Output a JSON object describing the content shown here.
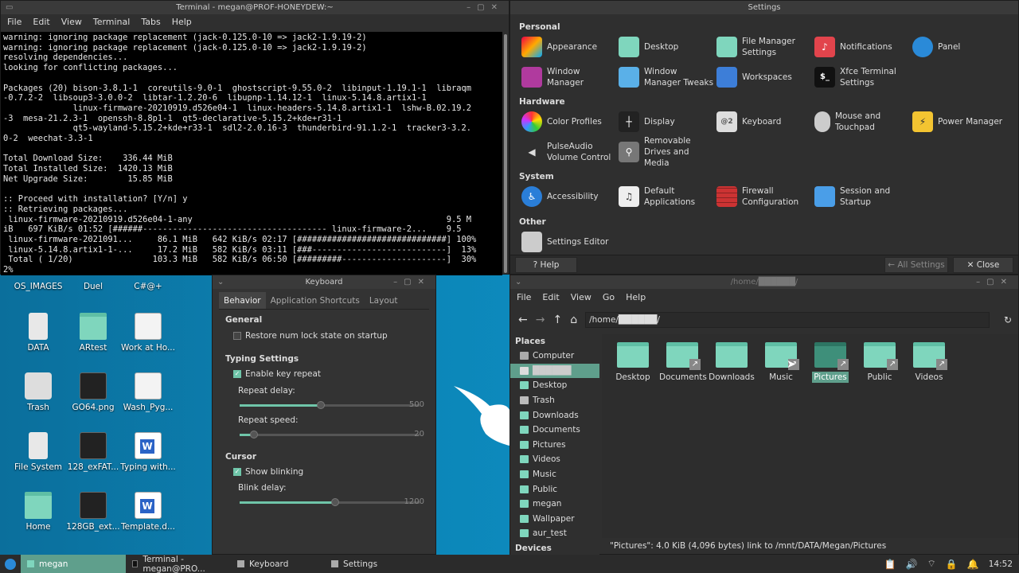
{
  "terminal": {
    "title": "Terminal - megan@PROF-HONEYDEW:~",
    "menu": [
      "File",
      "Edit",
      "View",
      "Terminal",
      "Tabs",
      "Help"
    ],
    "lines": [
      "warning: ignoring package replacement (jack-0.125.0-10 => jack2-1.9.19-2)",
      "warning: ignoring package replacement (jack-0.125.0-10 => jack2-1.9.19-2)",
      "resolving dependencies...",
      "looking for conflicting packages...",
      "",
      "Packages (20) bison-3.8.1-1  coreutils-9.0-1  ghostscript-9.55.0-2  libinput-1.19.1-1  libraqm",
      "-0.7.2-2  libsoup3-3.0.0-2  libtar-1.2.20-6  libupnp-1.14.12-1  linux-5.14.8.artix1-1",
      "              linux-firmware-20210919.d526e04-1  linux-headers-5.14.8.artix1-1  lshw-B.02.19.2",
      "-3  mesa-21.2.3-1  openssh-8.8p1-1  qt5-declarative-5.15.2+kde+r31-1",
      "              qt5-wayland-5.15.2+kde+r33-1  sdl2-2.0.16-3  thunderbird-91.1.2-1  tracker3-3.2.",
      "0-2  weechat-3.3-1",
      "",
      "Total Download Size:    336.44 MiB",
      "Total Installed Size:  1420.13 MiB",
      "Net Upgrade Size:        15.85 MiB",
      "",
      ":: Proceed with installation? [Y/n] y",
      ":: Retrieving packages...",
      " linux-firmware-20210919.d526e04-1-any                                                   9.5 M",
      "iB   697 KiB/s 01:52 [######------------------------------------- linux-firmware-2...    9.5",
      " linux-firmware-2021091...     86.1 MiB   642 KiB/s 02:17 [##############################] 100%",
      " linux-5.14.8.artix1-1-...     17.2 MiB   582 KiB/s 03:11 [###---------------------------]  13%",
      " Total ( 1/20)                103.3 MiB   582 KiB/s 06:50 [#########---------------------]  30%",
      "2%"
    ]
  },
  "settings": {
    "title": "Settings",
    "sections": {
      "personal": "Personal",
      "hardware": "Hardware",
      "system": "System",
      "other": "Other"
    },
    "items": {
      "appearance": "Appearance",
      "desktop": "Desktop",
      "file_manager": "File Manager Settings",
      "notifications": "Notifications",
      "panel": "Panel",
      "window_manager": "Window Manager",
      "wm_tweaks": "Window Manager Tweaks",
      "workspaces": "Workspaces",
      "terminal_settings": "Xfce Terminal Settings",
      "color_profiles": "Color Profiles",
      "display": "Display",
      "keyboard": "Keyboard",
      "mouse": "Mouse and Touchpad",
      "power": "Power Manager",
      "pulseaudio": "PulseAudio Volume Control",
      "removable": "Removable Drives and Media",
      "accessibility": "Accessibility",
      "default_apps": "Default Applications",
      "firewall": "Firewall Configuration",
      "session": "Session and Startup",
      "settings_editor": "Settings Editor"
    },
    "terminal_icon_text": "$_",
    "keyboard_icon_text": "@2",
    "help": "? Help",
    "all_settings": "← All Settings",
    "close": "✕ Close"
  },
  "keyboard": {
    "title": "Keyboard",
    "tabs": [
      "Behavior",
      "Application Shortcuts",
      "Layout"
    ],
    "general": "General",
    "numlock": "Restore num lock state on startup",
    "numlock_checked": false,
    "typing": "Typing Settings",
    "key_repeat": "Enable key repeat",
    "key_repeat_checked": true,
    "repeat_delay_label": "Repeat delay:",
    "repeat_delay_value": "500",
    "repeat_delay_fraction": 0.45,
    "repeat_speed_label": "Repeat speed:",
    "repeat_speed_value": "20",
    "repeat_speed_fraction": 0.08,
    "cursor": "Cursor",
    "blinking": "Show blinking",
    "blinking_checked": true,
    "blink_delay_label": "Blink delay:",
    "blink_delay_value": "1200",
    "blink_delay_fraction": 0.53
  },
  "files": {
    "menu": [
      "File",
      "Edit",
      "View",
      "Go",
      "Help"
    ],
    "path": "/home/██████/",
    "places_header": "Places",
    "devices_header": "Devices",
    "places": [
      "Computer",
      "██████",
      "Desktop",
      "Trash",
      "Downloads",
      "Documents",
      "Pictures",
      "Videos",
      "Music",
      "Public",
      "megan",
      "Wallpaper",
      "aur_test"
    ],
    "folders": [
      "Desktop",
      "Documents",
      "Downloads",
      "Music",
      "Pictures",
      "Public",
      "Videos"
    ],
    "status": "\"Pictures\": 4.0 KiB (4,096 bytes) link to /mnt/DATA/Megan/Pictures"
  },
  "desktop": {
    "top_labels": [
      "OS_IMAGES",
      "Duel",
      "C#@+"
    ],
    "icons": [
      {
        "label": "DATA",
        "kind": "drive"
      },
      {
        "label": "ARtest",
        "kind": "folder"
      },
      {
        "label": "Work at Ho...",
        "kind": "doc"
      },
      {
        "label": "Trash",
        "kind": "trash"
      },
      {
        "label": "GO64.png",
        "kind": "black"
      },
      {
        "label": "Wash_Pyg...",
        "kind": "doc"
      },
      {
        "label": "File System",
        "kind": "drive"
      },
      {
        "label": "128_exFAT...",
        "kind": "black"
      },
      {
        "label": "Typing with...",
        "kind": "word"
      },
      {
        "label": "Home",
        "kind": "folder"
      },
      {
        "label": "128GB_ext...",
        "kind": "black"
      },
      {
        "label": "Template.d...",
        "kind": "word"
      }
    ]
  },
  "taskbar": {
    "items": [
      "megan",
      "Terminal - megan@PRO...",
      "Keyboard",
      "Settings"
    ],
    "clock": "14:52"
  },
  "colors": {
    "accent": "#6fc5a9",
    "selection": "#5f9f8c",
    "desktop": "#0c86b8"
  }
}
